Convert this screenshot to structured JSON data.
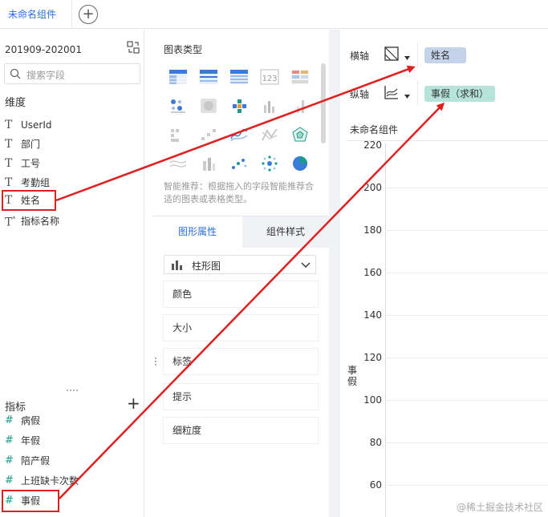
{
  "tabs": {
    "active": "未命名组件"
  },
  "data_panel": {
    "period": "201909-202001",
    "search_placeholder": "搜索字段",
    "dimension_title": "维度",
    "dimensions": [
      "UserId",
      "部门",
      "工号",
      "考勤组",
      "姓名",
      "指标名称"
    ],
    "measure_title": "指标",
    "measures": [
      "病假",
      "年假",
      "陪产假",
      "上班缺卡次数",
      "事假"
    ]
  },
  "chart_type_panel": {
    "title": "图表类型",
    "hint": "智能推荐：根据拖入的字段智能推荐合适的图表或表格类型。",
    "tab_graph": "图形属性",
    "tab_style": "组件样式",
    "chart_select": "柱形图",
    "properties": [
      "颜色",
      "大小",
      "标签",
      "提示",
      "细粒度"
    ]
  },
  "chart_panel": {
    "x_axis_label": "横轴",
    "y_axis_label": "纵轴",
    "x_field": "姓名",
    "y_field": "事假（求和）",
    "component_title": "未命名组件",
    "y_ticks": [
      "220",
      "200",
      "180",
      "160",
      "140",
      "120",
      "100",
      "80",
      "60"
    ],
    "y_axis_title": "事假",
    "watermark": "@稀土掘金技术社区"
  },
  "colors": {
    "accent": "#2a6fdb",
    "highlight": "#e02020",
    "pill_x": "#c5d3ea",
    "pill_y": "#b6e3da"
  }
}
